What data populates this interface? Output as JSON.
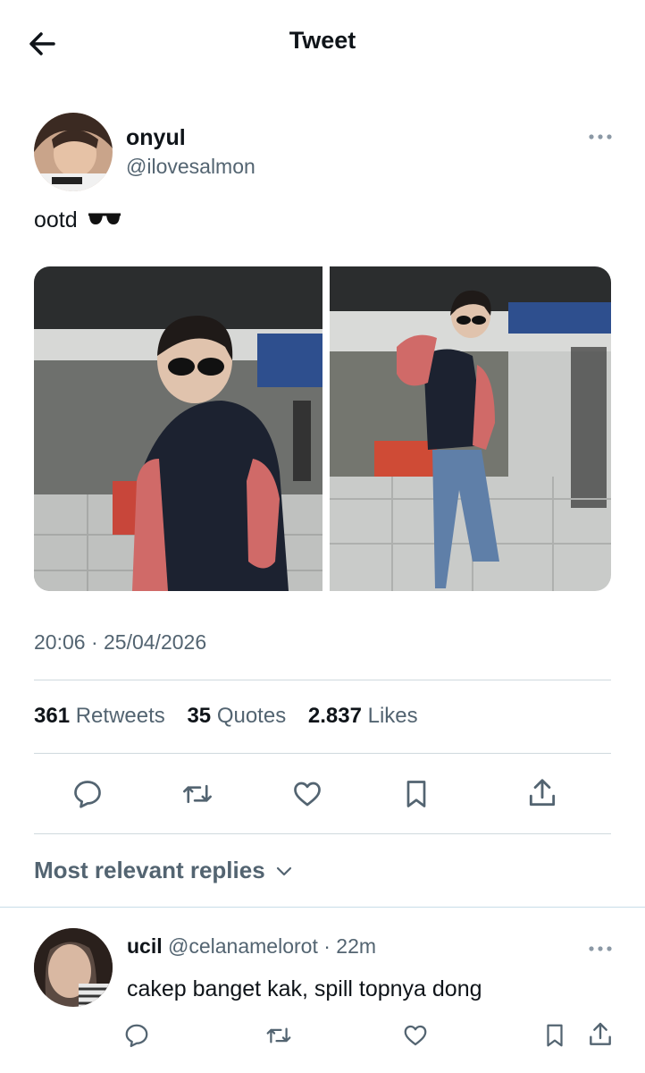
{
  "header": {
    "title": "Tweet"
  },
  "tweet": {
    "author_name": "onyul",
    "author_handle": "@ilovesalmon",
    "text": "ootd",
    "emoji": "sunglasses",
    "timestamp": "20:06 · 25/04/2026",
    "stats": {
      "retweets_count": "361",
      "retweets_label": "Retweets",
      "quotes_count": "35",
      "quotes_label": "Quotes",
      "likes_count": "2.837",
      "likes_label": "Likes"
    }
  },
  "replies": {
    "header": "Most relevant replies",
    "items": [
      {
        "name": "ucil",
        "handle": "@celanamelorot",
        "time": "· 22m",
        "text": "cakep banget kak, spill topnya dong"
      }
    ]
  },
  "icons": [
    "back-arrow-icon",
    "more-icon",
    "reply-icon",
    "retweet-icon",
    "like-icon",
    "bookmark-icon",
    "share-icon",
    "chevron-down-icon"
  ],
  "colors": {
    "text": "#0f1419",
    "secondary": "#536471",
    "divider": "#cfd9de",
    "background": "#ffffff"
  }
}
